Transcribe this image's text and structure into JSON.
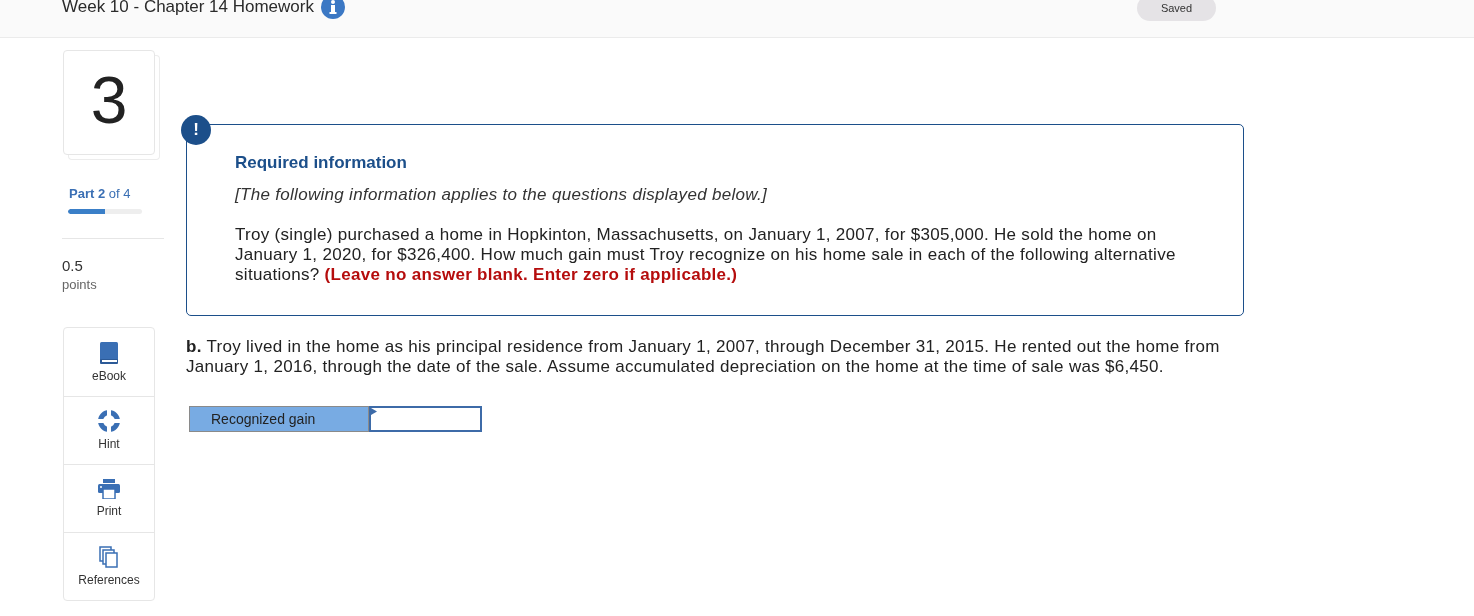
{
  "header": {
    "title": "Week 10 - Chapter 14 Homework",
    "status": "Saved"
  },
  "question": {
    "number": "3",
    "part": {
      "label": "Part 2",
      "suffix": "of 4",
      "level": 0.5
    },
    "points": {
      "value": "0.5",
      "label": "points"
    }
  },
  "tools": [
    {
      "kind": "ebook",
      "label": "eBook"
    },
    {
      "kind": "hint",
      "label": "Hint"
    },
    {
      "kind": "print",
      "label": "Print"
    },
    {
      "kind": "references",
      "label": "References"
    }
  ],
  "required_info": {
    "badge": "!",
    "title": "Required information",
    "note": "[The following information applies to the questions displayed below.]",
    "text": "Troy (single) purchased a home in Hopkinton, Massachusetts, on January 1, 2007, for $305,000. He sold the home on January 1, 2020, for $326,400. How much gain must Troy recognize on his home sale in each of the following alternative situations?",
    "instruction": "(Leave no answer blank. Enter zero if applicable.)"
  },
  "part_b": {
    "text": "**b.** Troy lived in the home as his principal residence from January 1, 2007, through December 31, 2015. He rented out the home from January 1, 2016, through the date of the sale. Assume accumulated depreciation on the home at the time of sale was $6,450."
  },
  "answer": {
    "label": "Recognized gain"
  }
}
